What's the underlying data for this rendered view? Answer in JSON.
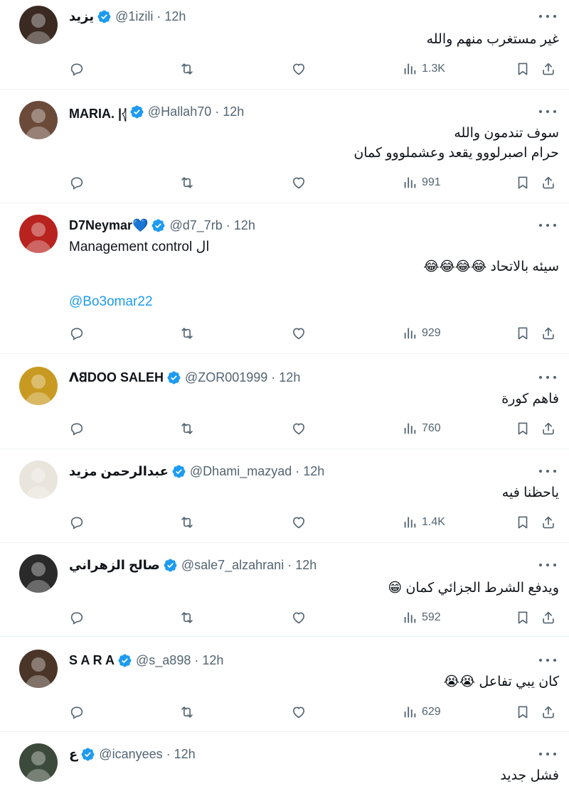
{
  "tweets": [
    {
      "name": "يزيد",
      "handle": "@1izili",
      "time": "12h",
      "lines": [
        "غير مستغرب منهم والله"
      ],
      "views": "1.3K",
      "avatar_color": "#3a2a22"
    },
    {
      "name": "MARIA. |𓂆",
      "handle": "@Hallah70",
      "time": "12h",
      "lines": [
        "سوف تندمون والله",
        "حرام اصبرلووو يقعد وعشملووو كمان"
      ],
      "views": "991",
      "avatar_color": "#6b4a3a"
    },
    {
      "name": "D7Neymar💙",
      "handle": "@d7_7rb",
      "time": "12h",
      "lines": [
        "ال Management control",
        "سيئه بالاتحاد 😂😂😂😂"
      ],
      "mention": "@Bo3omar22",
      "views": "929",
      "avatar_color": "#b8231f"
    },
    {
      "name": "ꓥ𐐒DOO SALEH",
      "handle": "@ZOR001999",
      "time": "12h",
      "lines": [
        "فاهم كورة"
      ],
      "views": "760",
      "avatar_color": "#c99a22"
    },
    {
      "name": "عبدالرحمن مزيد",
      "handle": "@Dhami_mazyad",
      "time": "12h",
      "lines": [
        "ياحظنا فيه"
      ],
      "views": "1.4K",
      "avatar_color": "#e9e4dc"
    },
    {
      "name": "صالح الزهراني",
      "handle": "@sale7_alzahrani",
      "time": "12h",
      "lines": [
        "ويدفع الشرط الجزائي كمان 😁"
      ],
      "views": "592",
      "avatar_color": "#2a2a2a"
    },
    {
      "name": "S A R A",
      "handle": "@s_a898",
      "time": "12h",
      "lines": [
        "كان يبي تفاعل 😭😭"
      ],
      "views": "629",
      "avatar_color": "#4a3528"
    },
    {
      "name": "ع",
      "handle": "@icanyees",
      "time": "12h",
      "lines": [
        "فشل جديد"
      ],
      "views": "",
      "avatar_color": "#3b4a3a"
    }
  ],
  "colors": {
    "verified": "#1d9bf0",
    "muted": "#536471",
    "link": "#1d9bf0",
    "divider": "#eff3f4"
  },
  "icons": [
    "reply-icon",
    "retweet-icon",
    "like-icon",
    "views-icon",
    "bookmark-icon",
    "share-icon",
    "more-icon",
    "verified-badge-icon"
  ]
}
